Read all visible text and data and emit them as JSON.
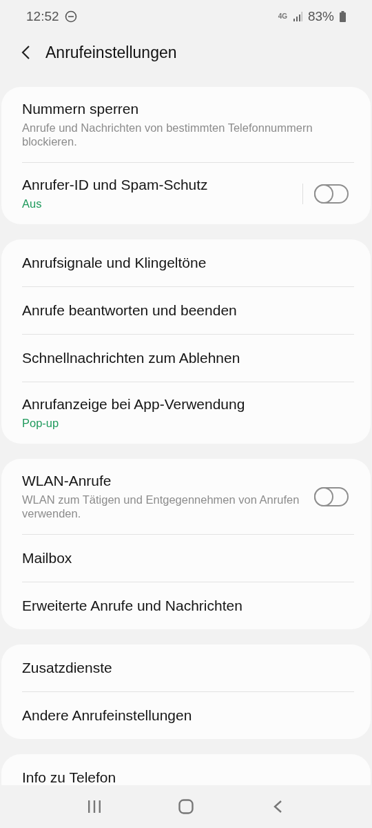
{
  "status_bar": {
    "time": "12:52",
    "network": "4G",
    "battery": "83%"
  },
  "header": {
    "title": "Anrufeinstellungen"
  },
  "groups": [
    {
      "items": [
        {
          "kind": "text",
          "title": "Nummern sperren",
          "subtitle": "Anrufe und Nachrichten von bestimmten Telefonnummern blockieren.",
          "subtitle_highlighted": false
        },
        {
          "kind": "switch",
          "title": "Anrufer-ID und Spam-Schutz",
          "subtitle": "Aus",
          "subtitle_highlighted": true,
          "on": false,
          "separated": true
        }
      ]
    },
    {
      "items": [
        {
          "kind": "text",
          "title": "Anrufsignale und Klingeltöne"
        },
        {
          "kind": "text",
          "title": "Anrufe beantworten und beenden"
        },
        {
          "kind": "text",
          "title": "Schnellnachrichten zum Ablehnen"
        },
        {
          "kind": "text",
          "title": "Anrufanzeige bei App-Verwendung",
          "subtitle": "Pop-up",
          "subtitle_highlighted": true
        }
      ]
    },
    {
      "items": [
        {
          "kind": "switch",
          "title": "WLAN-Anrufe",
          "subtitle": "WLAN zum Tätigen und Entgegennehmen von Anrufen verwenden.",
          "subtitle_highlighted": false,
          "on": false,
          "separated": false
        },
        {
          "kind": "text",
          "title": "Mailbox"
        },
        {
          "kind": "text",
          "title": "Erweiterte Anrufe und Nachrichten"
        }
      ]
    },
    {
      "items": [
        {
          "kind": "text",
          "title": "Zusatzdienste"
        },
        {
          "kind": "text",
          "title": "Andere Anrufeinstellungen"
        }
      ]
    },
    {
      "items": [
        {
          "kind": "text",
          "title": "Info zu Telefon"
        }
      ]
    }
  ]
}
